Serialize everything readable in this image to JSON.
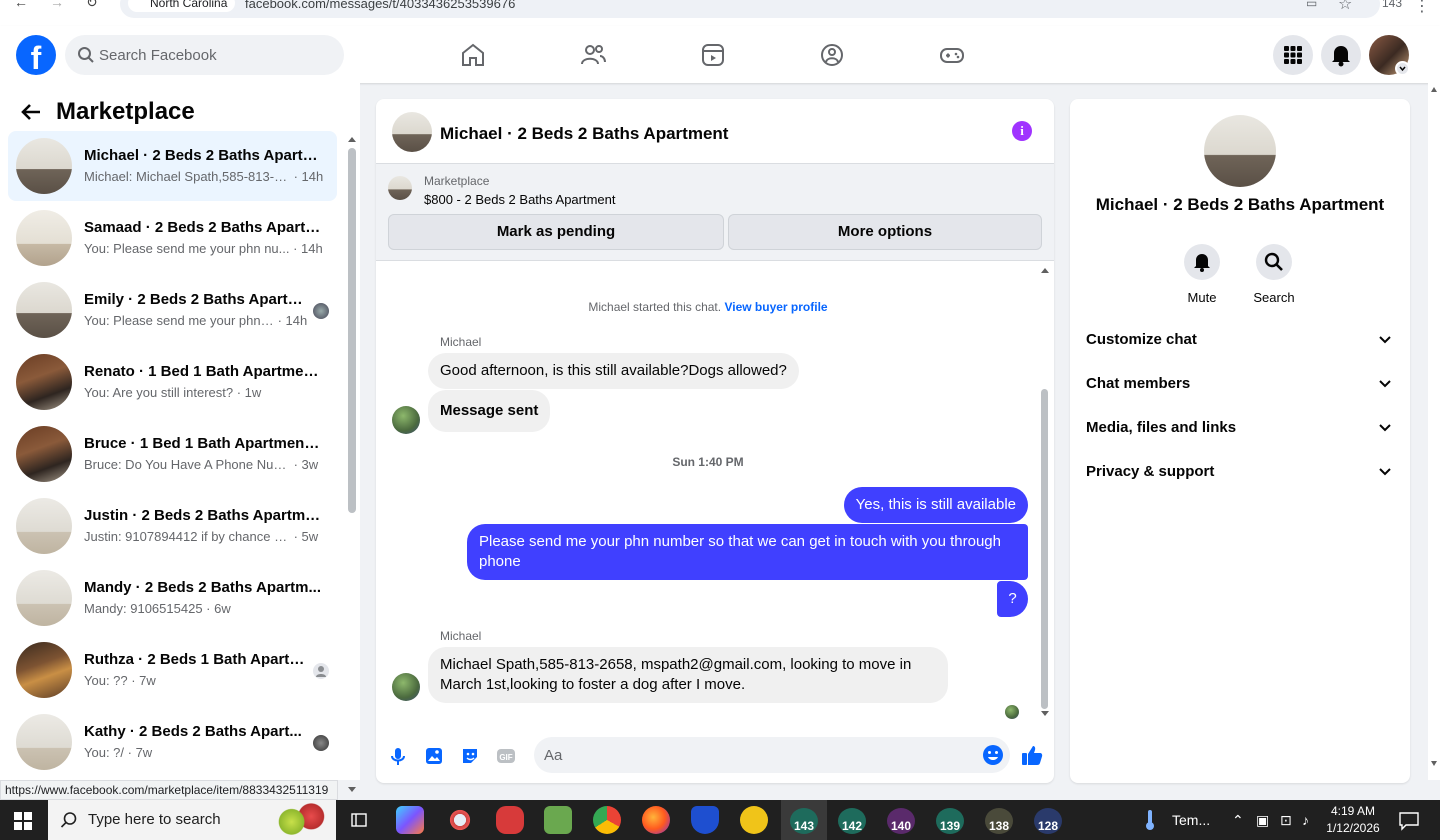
{
  "browser": {
    "location_chip": "North Carolina",
    "url": "facebook.com/messages/t/4033436253539676",
    "right_text": "143"
  },
  "header": {
    "search_placeholder": "Search Facebook"
  },
  "left_pane": {
    "title": "Marketplace",
    "conversations": [
      {
        "name": "Michael · 2 Beds 2 Baths Apartm...",
        "snippet": "Michael: Michael Spath,585-813-2...",
        "time": " · 14h",
        "active": true
      },
      {
        "name": "Samaad · 2 Beds 2 Baths Apartm...",
        "snippet": "You: Please send me your phn nu...",
        "time": " · 14h"
      },
      {
        "name": "Emily · 2 Beds 2 Baths Apartm...",
        "snippet": "You: Please send me your phn ...",
        "time": " · 14h"
      },
      {
        "name": "Renato · 1 Bed 1 Bath Apartment...",
        "snippet": "You: Are you still interest?",
        "time": " · 1w"
      },
      {
        "name": "Bruce · 1 Bed 1 Bath Apartment/...",
        "snippet": "Bruce: Do You Have A Phone Num...",
        "time": " · 3w"
      },
      {
        "name": "Justin · 2 Beds 2 Baths Apartment",
        "snippet": "Justin: 9107894412 if by chance yo...",
        "time": " · 5w"
      },
      {
        "name": "Mandy · 2 Beds 2 Baths Apartm...",
        "snippet": "Mandy: 9106515425",
        "time": " · 6w"
      },
      {
        "name": "Ruthza · 2 Beds 1 Bath Apartm...",
        "snippet": "You: ??",
        "time": " · 7w"
      },
      {
        "name": "Kathy · 2 Beds 2 Baths Apart...",
        "snippet": "You: ?/",
        "time": " · 7w"
      }
    ],
    "status_url": "https://www.facebook.com/marketplace/item/8833432511319"
  },
  "chat": {
    "title": "Michael · 2 Beds 2 Baths Apartment",
    "listing": {
      "kicker": "Marketplace",
      "price_line": "$800 - 2 Beds 2 Baths Apartment",
      "btn_pending": "Mark as pending",
      "btn_more": "More options"
    },
    "started_text": "Michael started this chat.",
    "view_profile": "View buyer profile",
    "sender_1": "Michael",
    "msg_1": "Good afternoon, is this still available?Dogs allowed?",
    "msg_2": "Message sent",
    "timestamp": "Sun 1:40 PM",
    "out_1": "Yes, this is still available",
    "out_2": "Please send me your phn number so that we can get in touch with you through phone",
    "out_3": "?",
    "sender_2": "Michael",
    "msg_3": "Michael Spath,585-813-2658, mspath2@gmail.com, looking to move in March 1st,looking to foster a dog after I move.",
    "composer_placeholder": "Aa"
  },
  "right_pane": {
    "name": "Michael · 2 Beds 2 Baths Apartment",
    "mute_label": "Mute",
    "search_label": "Search",
    "rows": [
      "Customize chat",
      "Chat members",
      "Media, files and links",
      "Privacy & support"
    ]
  },
  "taskbar": {
    "search_placeholder": "Type here to search",
    "badges": [
      "143",
      "142",
      "140",
      "139",
      "138",
      "128"
    ],
    "weather": "Tem...",
    "time": "4:19 AM",
    "date": "1/12/2026"
  },
  "colors": {
    "fb_blue": "#0866ff",
    "outgoing_bubble": "#4040ff",
    "info_purple": "#a033ff"
  }
}
